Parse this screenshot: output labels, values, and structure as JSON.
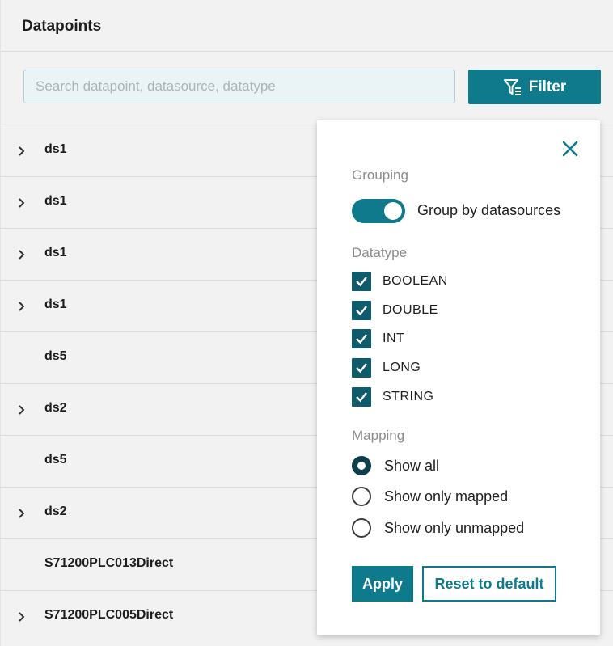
{
  "panel": {
    "title": "Datapoints"
  },
  "search": {
    "placeholder": "Search datapoint, datasource, datatype",
    "value": ""
  },
  "filter_button": {
    "label": "Filter",
    "icon": "filter-icon"
  },
  "list": {
    "rows": [
      {
        "label": "ds1",
        "expandable": true
      },
      {
        "label": "ds1",
        "expandable": true
      },
      {
        "label": "ds1",
        "expandable": true
      },
      {
        "label": "ds1",
        "expandable": true
      },
      {
        "label": "ds5",
        "expandable": false
      },
      {
        "label": "ds2",
        "expandable": true
      },
      {
        "label": "ds5",
        "expandable": false
      },
      {
        "label": "ds2",
        "expandable": true
      },
      {
        "label": "S71200PLC013Direct",
        "expandable": false
      },
      {
        "label": "S71200PLC005Direct",
        "expandable": true
      }
    ]
  },
  "popover": {
    "close_icon": "close-icon",
    "grouping": {
      "title": "Grouping",
      "toggle_label": "Group by datasources",
      "toggle_on": true
    },
    "datatype": {
      "title": "Datatype",
      "options": [
        {
          "label": "BOOLEAN",
          "checked": true
        },
        {
          "label": "DOUBLE",
          "checked": true
        },
        {
          "label": "INT",
          "checked": true
        },
        {
          "label": "LONG",
          "checked": true
        },
        {
          "label": "STRING",
          "checked": true
        }
      ]
    },
    "mapping": {
      "title": "Mapping",
      "options": [
        {
          "label": "Show all",
          "selected": true
        },
        {
          "label": "Show only mapped",
          "selected": false
        },
        {
          "label": "Show only unmapped",
          "selected": false
        }
      ]
    },
    "apply_label": "Apply",
    "reset_label": "Reset to default"
  },
  "colors": {
    "accent": "#0e7a8c",
    "checkbox": "#0e5b6b",
    "background": "#f2f2f2"
  }
}
